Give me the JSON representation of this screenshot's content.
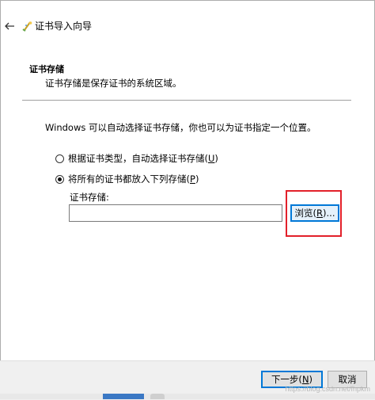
{
  "window": {
    "title": "证书导入向导",
    "icons": {
      "back": "back-arrow-icon",
      "wizard": "certificate-wizard-icon"
    }
  },
  "section": {
    "header": "证书存储",
    "description": "证书存储是保存证书的系统区域。"
  },
  "intro": "Windows 可以自动选择证书存储，你也可以为证书指定一个位置。",
  "options": [
    {
      "label_pre": "根据证书类型，自动选择证书存储(",
      "key": "U",
      "label_post": ")",
      "checked": false
    },
    {
      "label_pre": "将所有的证书都放入下列存储(",
      "key": "P",
      "label_post": ")",
      "checked": true
    }
  ],
  "store": {
    "label": "证书存储:",
    "value": "",
    "browse_pre": "浏览(",
    "browse_key": "R",
    "browse_post": ")..."
  },
  "footer": {
    "next_pre": "下一步(",
    "next_key": "N",
    "next_post": ")",
    "cancel": "取消"
  },
  "watermark": "https://blog.csdn.net/fhpkm",
  "colors": {
    "highlight": "#e2202a",
    "focus": "#0078d7",
    "taskbar_active": "#3b78c4"
  }
}
